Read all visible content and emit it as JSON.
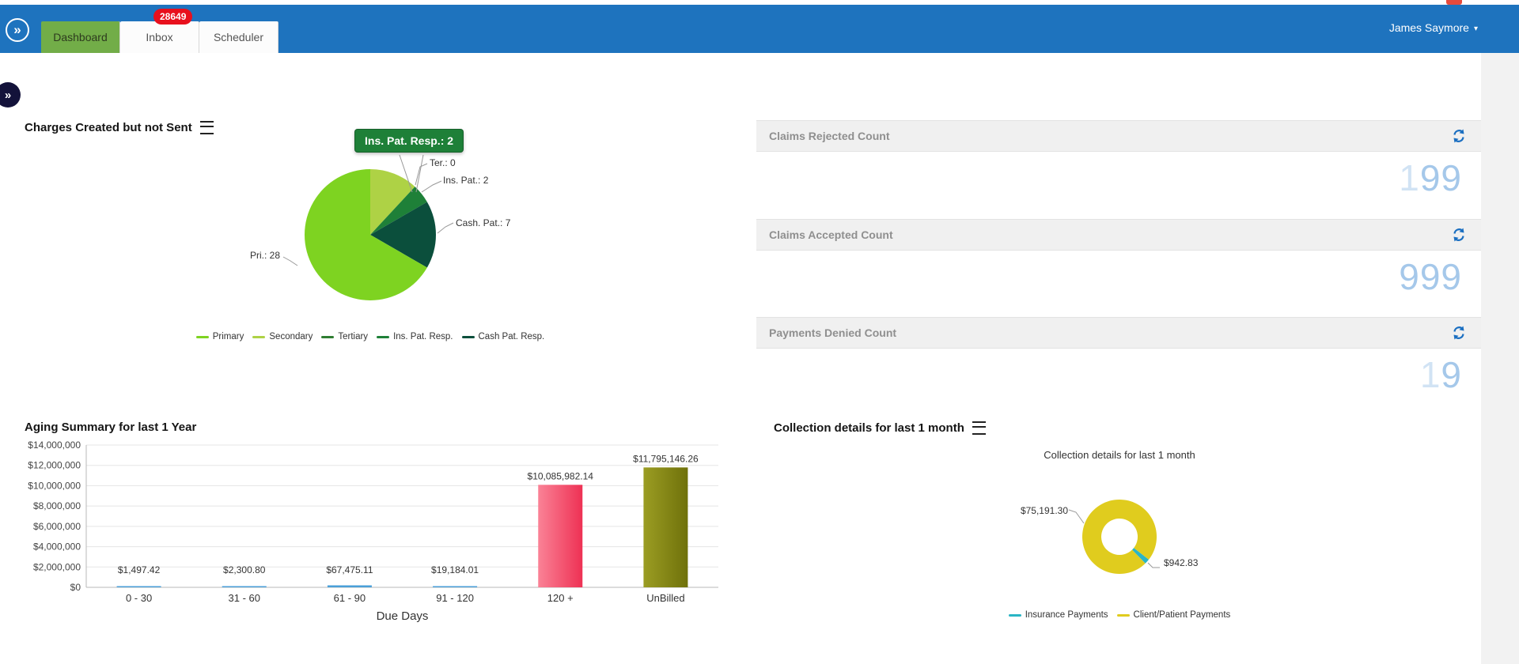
{
  "colors": {
    "header_blue": "#1e73be",
    "active_tab_green": "#72ad48",
    "badge_red": "#e8101d",
    "panel_value_blue": "#a5c8ea",
    "refresh_blue": "#1b6fc1",
    "tooltip_green": "#1e8038"
  },
  "header": {
    "tabs": [
      {
        "label": "Dashboard",
        "active": true
      },
      {
        "label": "Inbox",
        "badge": "28649",
        "active": false
      },
      {
        "label": "Scheduler",
        "active": false
      }
    ],
    "user": "James Saymore"
  },
  "panels": [
    {
      "title": "Claims Rejected Count",
      "ghost": "1",
      "value": "99"
    },
    {
      "title": "Claims Accepted Count",
      "ghost": "",
      "value": "999"
    },
    {
      "title": "Payments Denied Count",
      "ghost": "1",
      "value": "9"
    }
  ],
  "charges": {
    "tooltip": "Ins. Pat. Resp.: 2",
    "labels": {
      "ter": "Ter.: 0",
      "ins": "Ins. Pat.: 2",
      "cash": "Cash. Pat.: 7",
      "pri": "Pri.: 28"
    }
  },
  "collection": {
    "callout_client": "$75,191.30",
    "callout_insurance": "$942.83"
  },
  "chart_data": [
    {
      "type": "pie",
      "title": "Charges Created but not Sent",
      "labels": [
        "Primary",
        "Secondary",
        "Tertiary",
        "Ins. Pat. Resp.",
        "Cash Pat. Resp."
      ],
      "values": [
        28,
        5,
        0,
        2,
        7
      ],
      "colors": [
        "#7ed321",
        "#aed245",
        "#2f7d32",
        "#1e8038",
        "#0b4f3c"
      ],
      "draw_order": [
        1,
        2,
        3,
        4,
        0
      ],
      "legend_position": "bottom"
    },
    {
      "type": "bar",
      "title": "Aging Summary for last 1 Year",
      "xlabel": "Due Days",
      "ylabel": "",
      "categories": [
        "0 - 30",
        "31 - 60",
        "61 - 90",
        "91 - 120",
        "120 +",
        "UnBilled"
      ],
      "values": [
        1497.42,
        2300.8,
        67475.11,
        19184.01,
        10085982.14,
        11795146.26
      ],
      "value_labels": [
        "$1,497.42",
        "$2,300.80",
        "$67,475.11",
        "$19,184.01",
        "$10,085,982.14",
        "$11,795,146.26"
      ],
      "colors": [
        "#4a9fd8",
        "#4a9fd8",
        "#4a9fd8",
        "#4a9fd8",
        "#f4516c",
        "#8b8d1a"
      ],
      "gradients": {
        "4": [
          "#fa8296",
          "#ee3154"
        ],
        "5": [
          "#9b9d23",
          "#6f710a"
        ]
      },
      "ylim": [
        0,
        14000000
      ],
      "ytick_step": 2000000,
      "ytick_labels": [
        "$0",
        "$2,000,000",
        "$4,000,000",
        "$6,000,000",
        "$8,000,000",
        "$10,000,000",
        "$12,000,000",
        "$14,000,000"
      ],
      "grid": true,
      "legend_position": "none"
    },
    {
      "type": "pie",
      "subtype": "donut",
      "title": "Collection details for last 1 month",
      "labels": [
        "Insurance Payments",
        "Client/Patient Payments"
      ],
      "values": [
        942.83,
        75191.3
      ],
      "value_labels": [
        "$942.83",
        "$75,191.30"
      ],
      "colors": [
        "#2ab5c5",
        "#e0cc1e"
      ],
      "legend_position": "bottom"
    }
  ]
}
